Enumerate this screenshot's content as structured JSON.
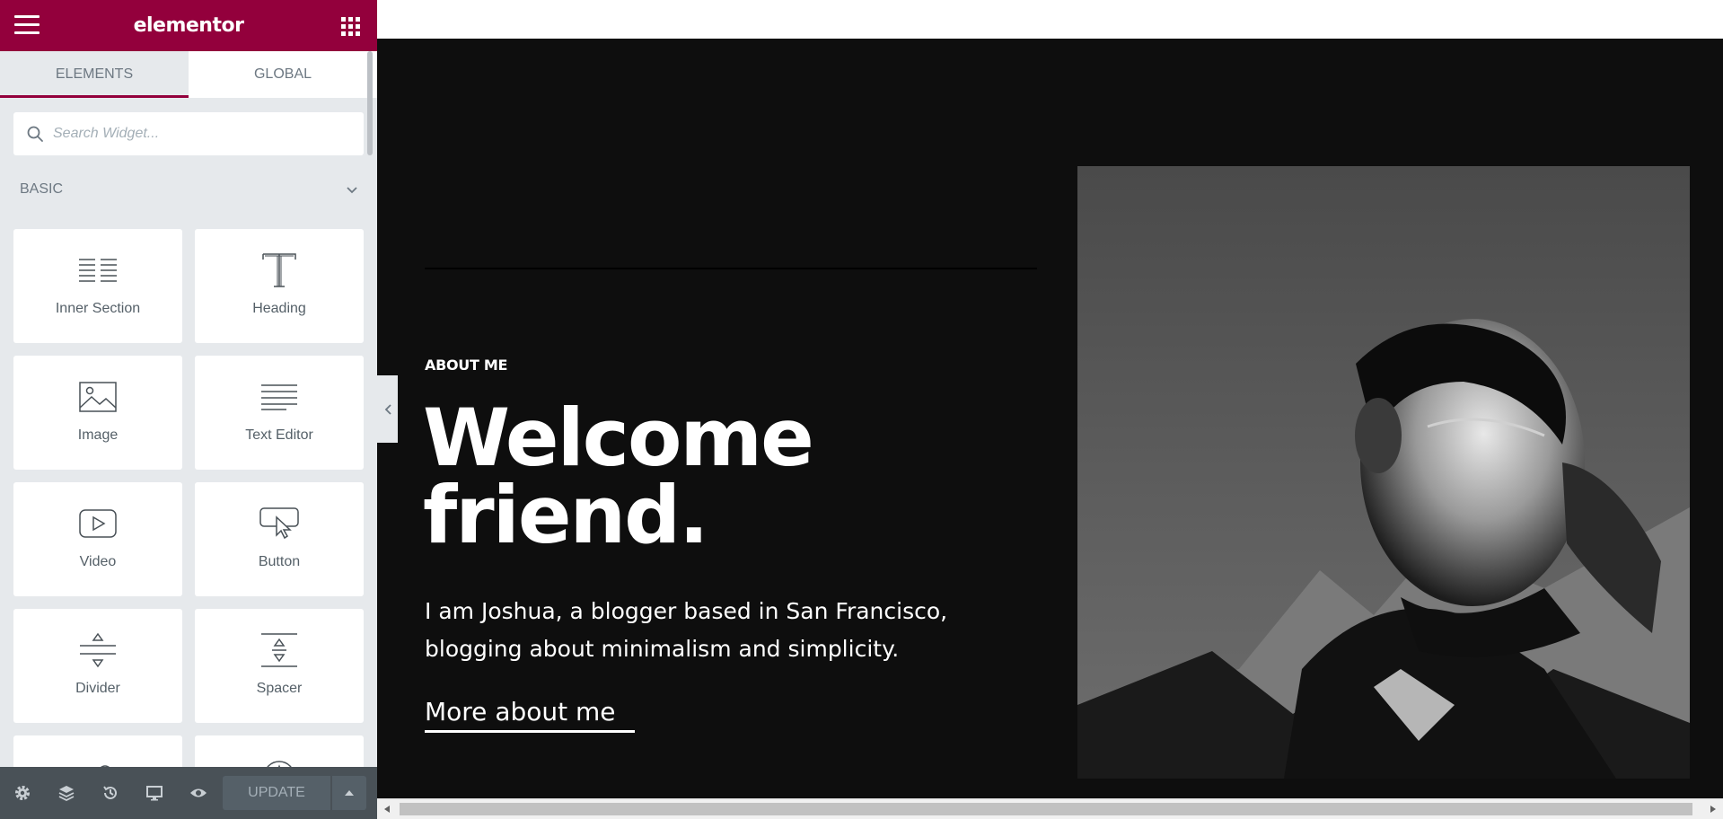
{
  "app": {
    "logo_text": "elementor",
    "brand_color": "#93003c"
  },
  "tabs": [
    {
      "label": "ELEMENTS",
      "active": true
    },
    {
      "label": "GLOBAL",
      "active": false
    }
  ],
  "search": {
    "placeholder": "Search Widget..."
  },
  "category": {
    "title": "BASIC"
  },
  "widgets": [
    {
      "label": "Inner Section",
      "icon": "inner-section-icon"
    },
    {
      "label": "Heading",
      "icon": "heading-icon"
    },
    {
      "label": "Image",
      "icon": "image-icon"
    },
    {
      "label": "Text Editor",
      "icon": "text-editor-icon"
    },
    {
      "label": "Video",
      "icon": "video-icon"
    },
    {
      "label": "Button",
      "icon": "button-icon"
    },
    {
      "label": "Divider",
      "icon": "divider-icon"
    },
    {
      "label": "Spacer",
      "icon": "spacer-icon"
    }
  ],
  "bottombar": {
    "icons": [
      "settings-icon",
      "navigator-layers-icon",
      "history-icon",
      "responsive-desktop-icon",
      "preview-eye-icon"
    ],
    "update_label": "UPDATE"
  },
  "page": {
    "eyebrow": "ABOUT ME",
    "headline_line1": "Welcome",
    "headline_line2": "friend.",
    "intro": "I am Joshua, a blogger based in San Francisco, blogging about minimalism and simplicity.",
    "link_label": "More about me",
    "background_color": "#0e0e0e"
  }
}
